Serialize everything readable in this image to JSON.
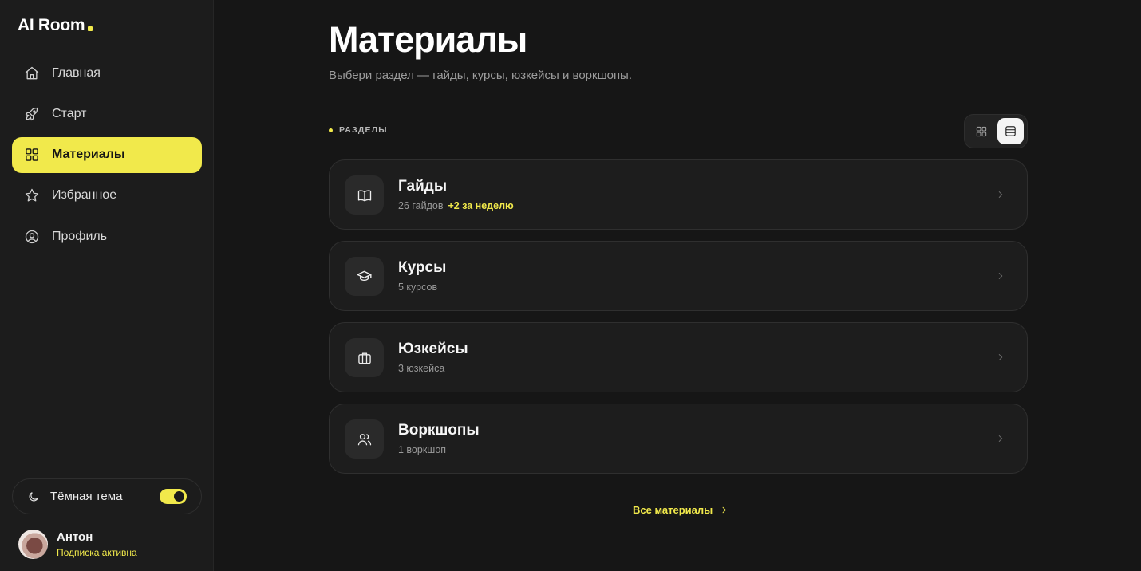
{
  "app": {
    "logo_text": "AI Room"
  },
  "colors": {
    "accent": "#f1e94b",
    "background": "#161616",
    "sidebar": "#1c1c1c",
    "card": "#1d1d1d"
  },
  "sidebar": {
    "items": [
      {
        "label": "Главная",
        "icon": "home-icon",
        "active": false
      },
      {
        "label": "Старт",
        "icon": "rocket-icon",
        "active": false
      },
      {
        "label": "Материалы",
        "icon": "grid-icon",
        "active": true
      },
      {
        "label": "Избранное",
        "icon": "star-icon",
        "active": false
      },
      {
        "label": "Профиль",
        "icon": "user-circle-icon",
        "active": false
      }
    ],
    "theme_toggle": {
      "label": "Тёмная тема",
      "icon": "moon-icon",
      "enabled": true
    },
    "user": {
      "name": "Антон",
      "status": "Подписка активна"
    }
  },
  "main": {
    "title": "Материалы",
    "subtitle": "Выбери раздел — гайды, курсы, юзкейсы и воркшопы.",
    "section_label": "РАЗДЕЛЫ",
    "view_switch": {
      "options": [
        "grid-view-icon",
        "list-view-icon"
      ],
      "selected": "list-view-icon"
    },
    "cards": [
      {
        "title": "Гайды",
        "meta": "26 гайдов",
        "badge": "+2 за неделю",
        "icon": "book-open-icon"
      },
      {
        "title": "Курсы",
        "meta": "5 курсов",
        "badge": "",
        "icon": "graduation-cap-icon"
      },
      {
        "title": "Юзкейсы",
        "meta": "3 юзкейса",
        "badge": "",
        "icon": "briefcase-icon"
      },
      {
        "title": "Воркшопы",
        "meta": "1 воркшоп",
        "badge": "",
        "icon": "users-icon"
      }
    ],
    "all_link": "Все материалы"
  }
}
